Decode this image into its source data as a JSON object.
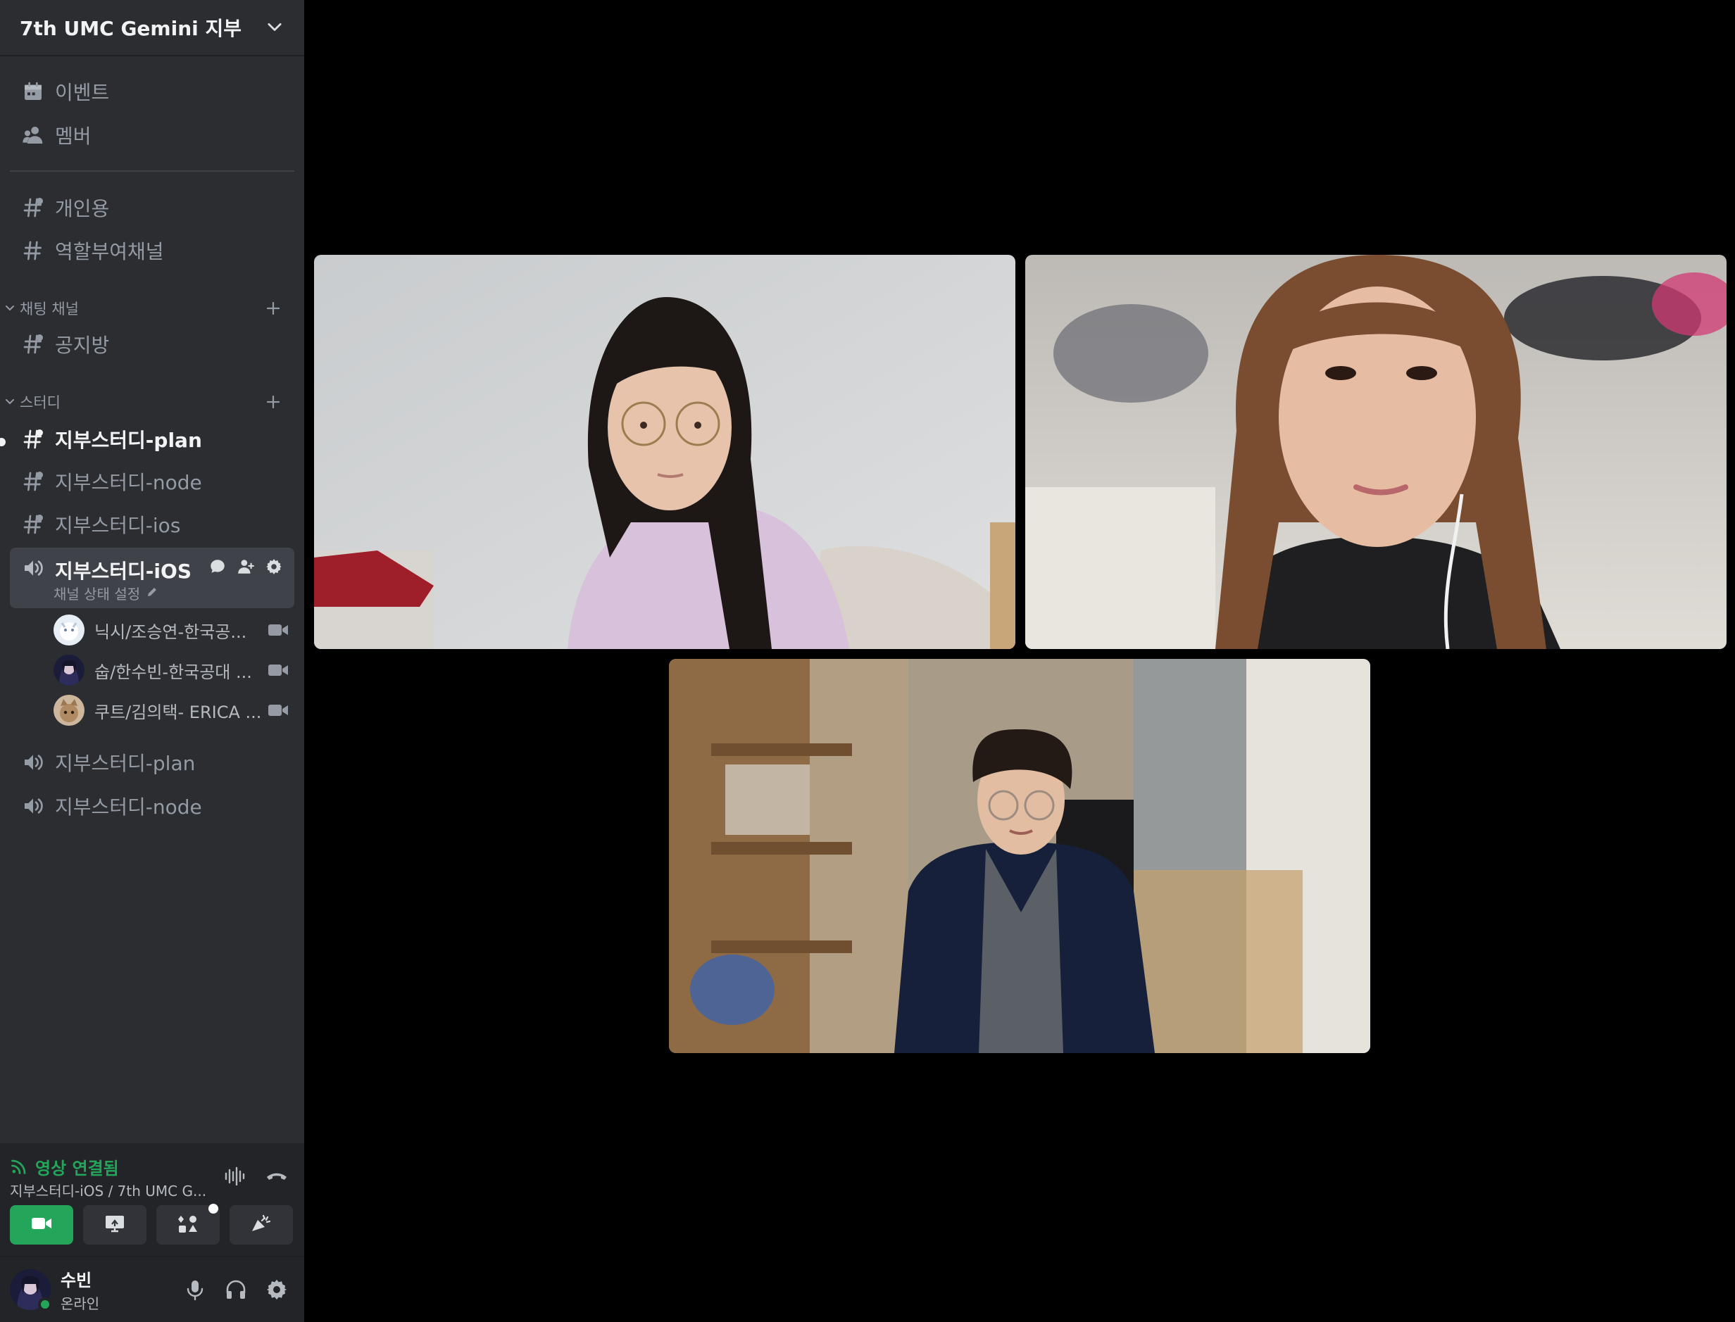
{
  "server": {
    "name": "7th UMC Gemini 지부"
  },
  "top_links": [
    {
      "label": "이벤트",
      "icon": "calendar-icon"
    },
    {
      "label": "멤버",
      "icon": "members-icon"
    }
  ],
  "text_channels": [
    {
      "label": "개인용",
      "icon": "text-channel-icon"
    },
    {
      "label": "역할부여채널",
      "icon": "hash-icon"
    }
  ],
  "categories": {
    "chat": {
      "label": "채팅 채널",
      "channels": [
        {
          "label": "공지방"
        }
      ]
    },
    "study": {
      "label": "스터디",
      "channels": [
        {
          "label": "지부스터디-plan",
          "unread": true
        },
        {
          "label": "지부스터디-node"
        },
        {
          "label": "지부스터디-ios"
        }
      ],
      "voice_active": {
        "label": "지부스터디-iOS",
        "status_setting": "채널 상태 설정",
        "members": [
          {
            "label": "닉시/조승연-한국공..."
          },
          {
            "label": "숩/한수빈-한국공대 ..."
          },
          {
            "label": "쿠트/김의택- ERICA ..."
          }
        ]
      },
      "voice_channels": [
        {
          "label": "지부스터디-plan"
        },
        {
          "label": "지부스터디-node"
        }
      ]
    }
  },
  "voice_panel": {
    "status": "영상 연결됨",
    "channel": "지부스터디-iOS / 7th UMC G..."
  },
  "user": {
    "name": "수빈",
    "status": "온라인"
  },
  "colors": {
    "sidebar_bg": "#2b2d31",
    "panel_bg": "#232428",
    "selected_bg": "#404249",
    "connected_green": "#23a55a",
    "muted_text": "#949ba4",
    "bright_text": "#f2f3f5",
    "stage_bg": "#000000"
  }
}
